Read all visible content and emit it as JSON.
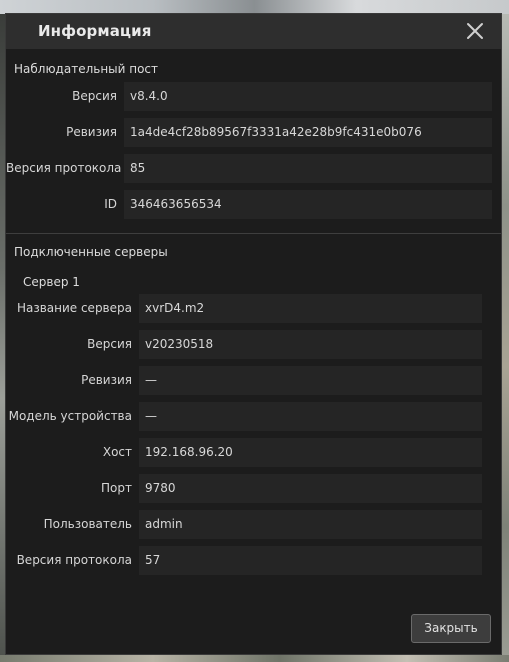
{
  "dialog": {
    "title": "Информация",
    "close_icon": "close-icon"
  },
  "observation_post": {
    "heading": "Наблюдательный пост",
    "fields": [
      {
        "label": "Версия",
        "value": "v8.4.0"
      },
      {
        "label": "Ревизия",
        "value": "1a4de4cf28b89567f3331a42e28b9fc431e0b076"
      },
      {
        "label": "Версия протокола",
        "value": "85"
      },
      {
        "label": "ID",
        "value": "346463656534"
      }
    ]
  },
  "connected_servers": {
    "heading": "Подключенные серверы",
    "servers": [
      {
        "name": "Сервер 1",
        "fields": [
          {
            "label": "Название сервера",
            "value": "xvrD4.m2"
          },
          {
            "label": "Версия",
            "value": "v20230518"
          },
          {
            "label": "Ревизия",
            "value": "—"
          },
          {
            "label": "Модель устройства",
            "value": "—"
          },
          {
            "label": "Хост",
            "value": "192.168.96.20"
          },
          {
            "label": "Порт",
            "value": "9780"
          },
          {
            "label": "Пользователь",
            "value": "admin"
          },
          {
            "label": "Версия протокола",
            "value": "57"
          }
        ]
      }
    ]
  },
  "footer": {
    "close_label": "Закрыть"
  }
}
